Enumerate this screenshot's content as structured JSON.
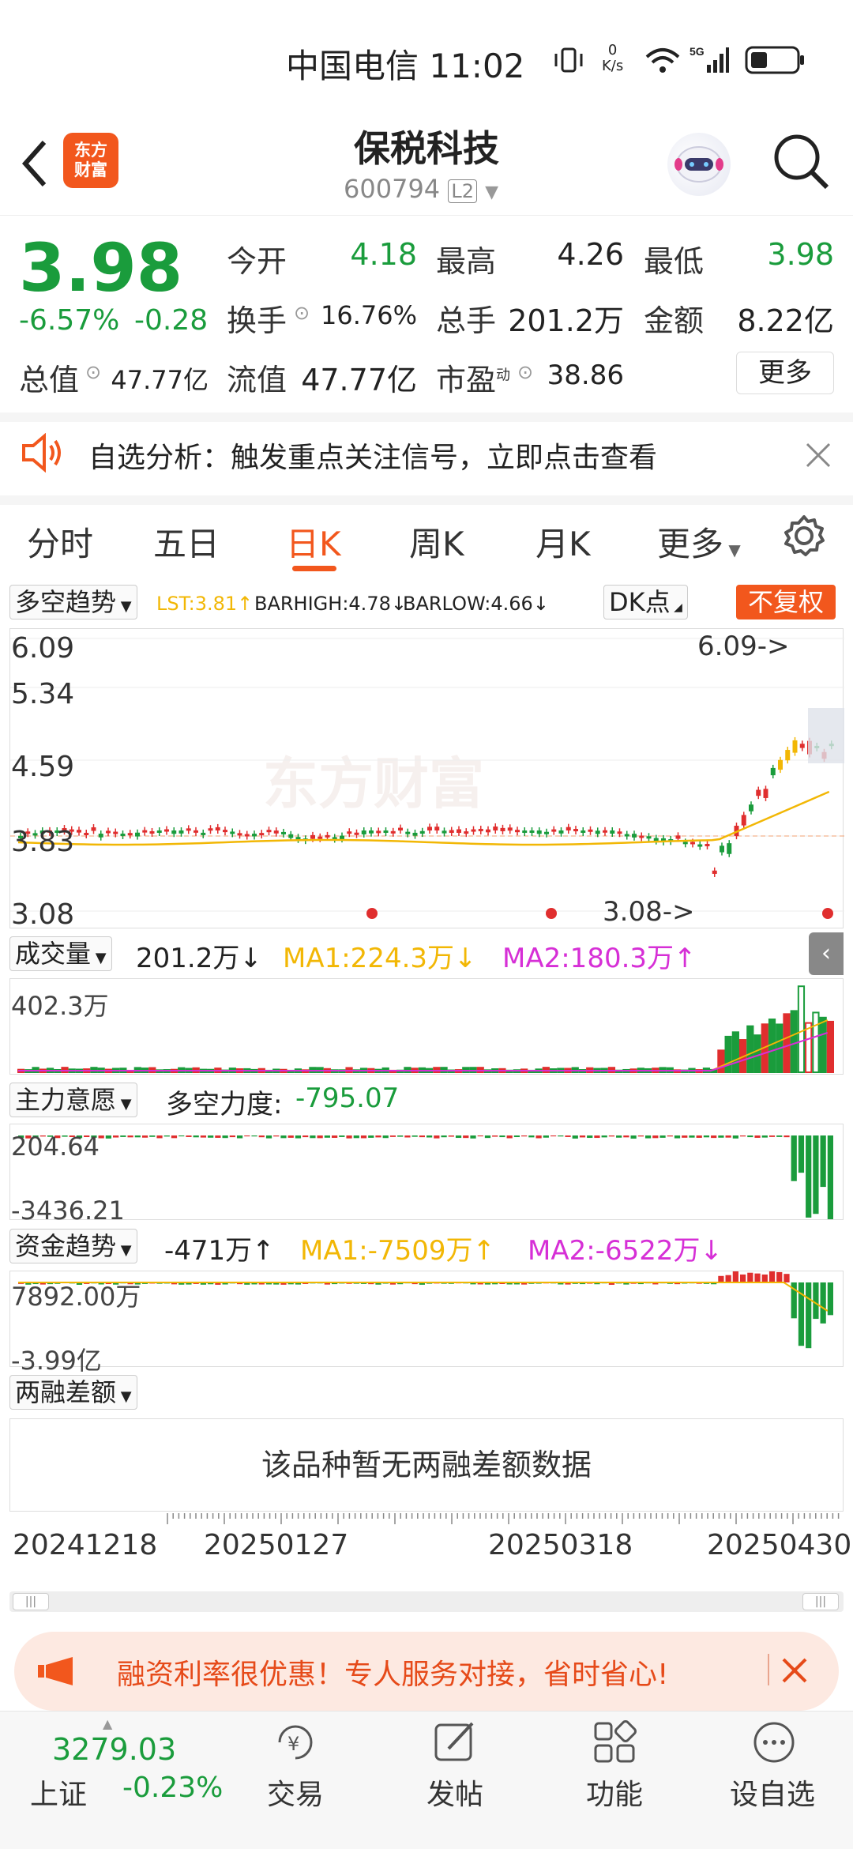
{
  "status_bar": {
    "carrier_time": "中国电信 11:02",
    "net_speed_top": "0",
    "net_speed_unit": "K/s"
  },
  "header": {
    "title": "保税科技",
    "code": "600794",
    "level": "L2",
    "logo_line1": "东方",
    "logo_line2": "财富"
  },
  "quote": {
    "price": "3.98",
    "change_pct": "-6.57%",
    "change_abs": "-0.28",
    "fields": [
      {
        "label": "今开",
        "value": "4.18"
      },
      {
        "label": "最高",
        "value": "4.26"
      },
      {
        "label": "最低",
        "value": "3.98"
      },
      {
        "label": "换手",
        "value": "16.76%"
      },
      {
        "label": "总手",
        "value": "201.2万"
      },
      {
        "label": "金额",
        "value": "8.22亿"
      },
      {
        "label": "总值",
        "value": "47.77亿"
      },
      {
        "label": "流值",
        "value": "47.77亿"
      },
      {
        "label": "市盈",
        "value": "38.86"
      }
    ],
    "pe_sup": "动",
    "more": "更多"
  },
  "notice": {
    "text": "自选分析：触发重点关注信号，立即点击查看"
  },
  "tabs": [
    "分时",
    "五日",
    "日K",
    "周K",
    "月K",
    "更多"
  ],
  "kline": {
    "indicator": "多空趋势",
    "lst": "LST:3.81↑",
    "barhigh": "BARHIGH:4.78↓",
    "barlow": "BARLOW:4.66↓",
    "dk": "DK点",
    "fq": "不复权",
    "y_labels": [
      "6.09",
      "5.34",
      "4.59",
      "3.83",
      "3.08"
    ],
    "high_mark": "6.09->",
    "low_mark": "3.08->",
    "watermark": "东方财富"
  },
  "volume": {
    "indicator": "成交量",
    "value": "201.2万↓",
    "ma1": "MA1:224.3万↓",
    "ma2": "MA2:180.3万↑",
    "max": "402.3万"
  },
  "zhuli": {
    "indicator": "主力意愿",
    "label": "多空力度:",
    "value": "-795.07",
    "top": "204.64",
    "bottom": "-3436.21"
  },
  "zijin": {
    "indicator": "资金趋势",
    "value": "-471万↑",
    "ma1": "MA1:-7509万↑",
    "ma2": "MA2:-6522万↓",
    "top": "7892.00万",
    "bottom": "-3.99亿"
  },
  "rongzi": {
    "indicator": "两融差额",
    "empty": "该品种暂无两融差额数据"
  },
  "dates": [
    "20241218",
    "20250127",
    "20250318",
    "20250430"
  ],
  "promo": {
    "text": "融资利率很优惠！专人服务对接，省时省心!"
  },
  "bottom_bar": {
    "index_value": "3279.03",
    "index_name": "上证",
    "index_change": "-0.23%",
    "items": [
      "交易",
      "发帖",
      "功能",
      "设自选"
    ]
  },
  "colors": {
    "accent": "#f2571d",
    "down": "#1a9c3c",
    "up": "#e02e2e",
    "ma_yellow": "#f2b705",
    "ma_magenta": "#d62fd6"
  }
}
